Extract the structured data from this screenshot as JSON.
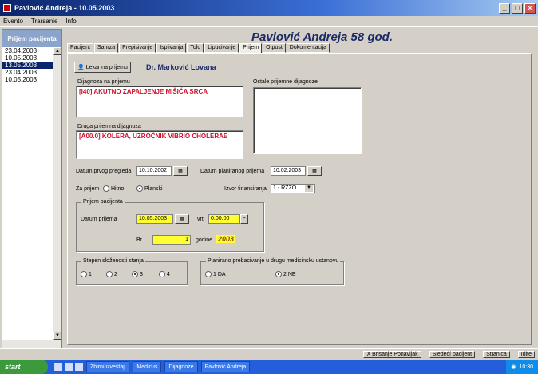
{
  "window": {
    "title": "Pavlović Andreja - 10.05.2003"
  },
  "menu": [
    "Evento",
    "Trarsanie",
    "Info"
  ],
  "sidebar": {
    "header": "Prijem pacijenta",
    "dates": [
      "23.04.2003",
      "10.05.2003",
      "13.05.2003",
      "23.04.2003",
      "10.05.2003"
    ],
    "selected_index": 2
  },
  "patient": {
    "name": "Pavlović Andreja",
    "age": "58 god."
  },
  "tabs": [
    "Pacijent",
    "Sahrza",
    "Prepisivanje",
    "Isplivanja",
    "Tolo",
    "Lipucivanje",
    "Prijem",
    "Otpust",
    "Dokumentacija"
  ],
  "active_tab": "Prijem",
  "doctor": {
    "button": "Lekar na prijemu",
    "name": "Dr. Marković Lovana"
  },
  "diagnosis": {
    "main_label": "Dijagnoza na prijemu",
    "main_value": "[I40] AKUTNO ZAPALJENJE MIŠIĆA SRCA",
    "other_label": "Druga prijemna dijagnoza",
    "other_value": "[A00.0] KOLERA, UZROČNIK VIBRIO CHOLERAE",
    "side_label": "Ostale prijemne dijagnoze",
    "side_value": ""
  },
  "dates": {
    "previous_label": "Datum prvog pregleda",
    "previous_value": "10.10.2002",
    "planned_label": "Datum planiranog prijema",
    "planned_value": "10.02.2003"
  },
  "admission_type": {
    "label": "Za prijem",
    "options": [
      "Hitno",
      "Planski"
    ],
    "selected": "Planski"
  },
  "financing": {
    "label": "Izvor finansiranja",
    "value": "1 - RZZO"
  },
  "admission": {
    "group_label": "Prijem pacijenta",
    "date_label": "Datum prijema",
    "date_value": "10.05.2003",
    "time_label": "vrt",
    "time_value": "0:00:00",
    "number_label": "Br.",
    "number_value": "1",
    "year_label": "godine",
    "year_value": "2003"
  },
  "severity": {
    "label": "Stepen složenosti stanja",
    "options": [
      "1",
      "2",
      "3",
      "4"
    ],
    "selected": "3"
  },
  "transfer": {
    "label": "Planirano prebacivanje u drugu medicinsku ustanovu",
    "options": [
      "1 DA",
      "2 NE"
    ],
    "selected": "2 NE"
  },
  "bottom_toolbar": [
    "X Brisanje Ponavljak",
    "Sledećí pacijent",
    "Stranica",
    "Idite"
  ],
  "taskbar": {
    "start": "start",
    "items": [
      "Zbirni izveštaji",
      "Medicus",
      "Dijagnoze",
      "Pavlović Andreja"
    ],
    "clock": "10:30"
  },
  "colors": {
    "accent": "#1c2a66",
    "diagnosis_text": "#d0102a",
    "highlight": "#ffff30"
  }
}
